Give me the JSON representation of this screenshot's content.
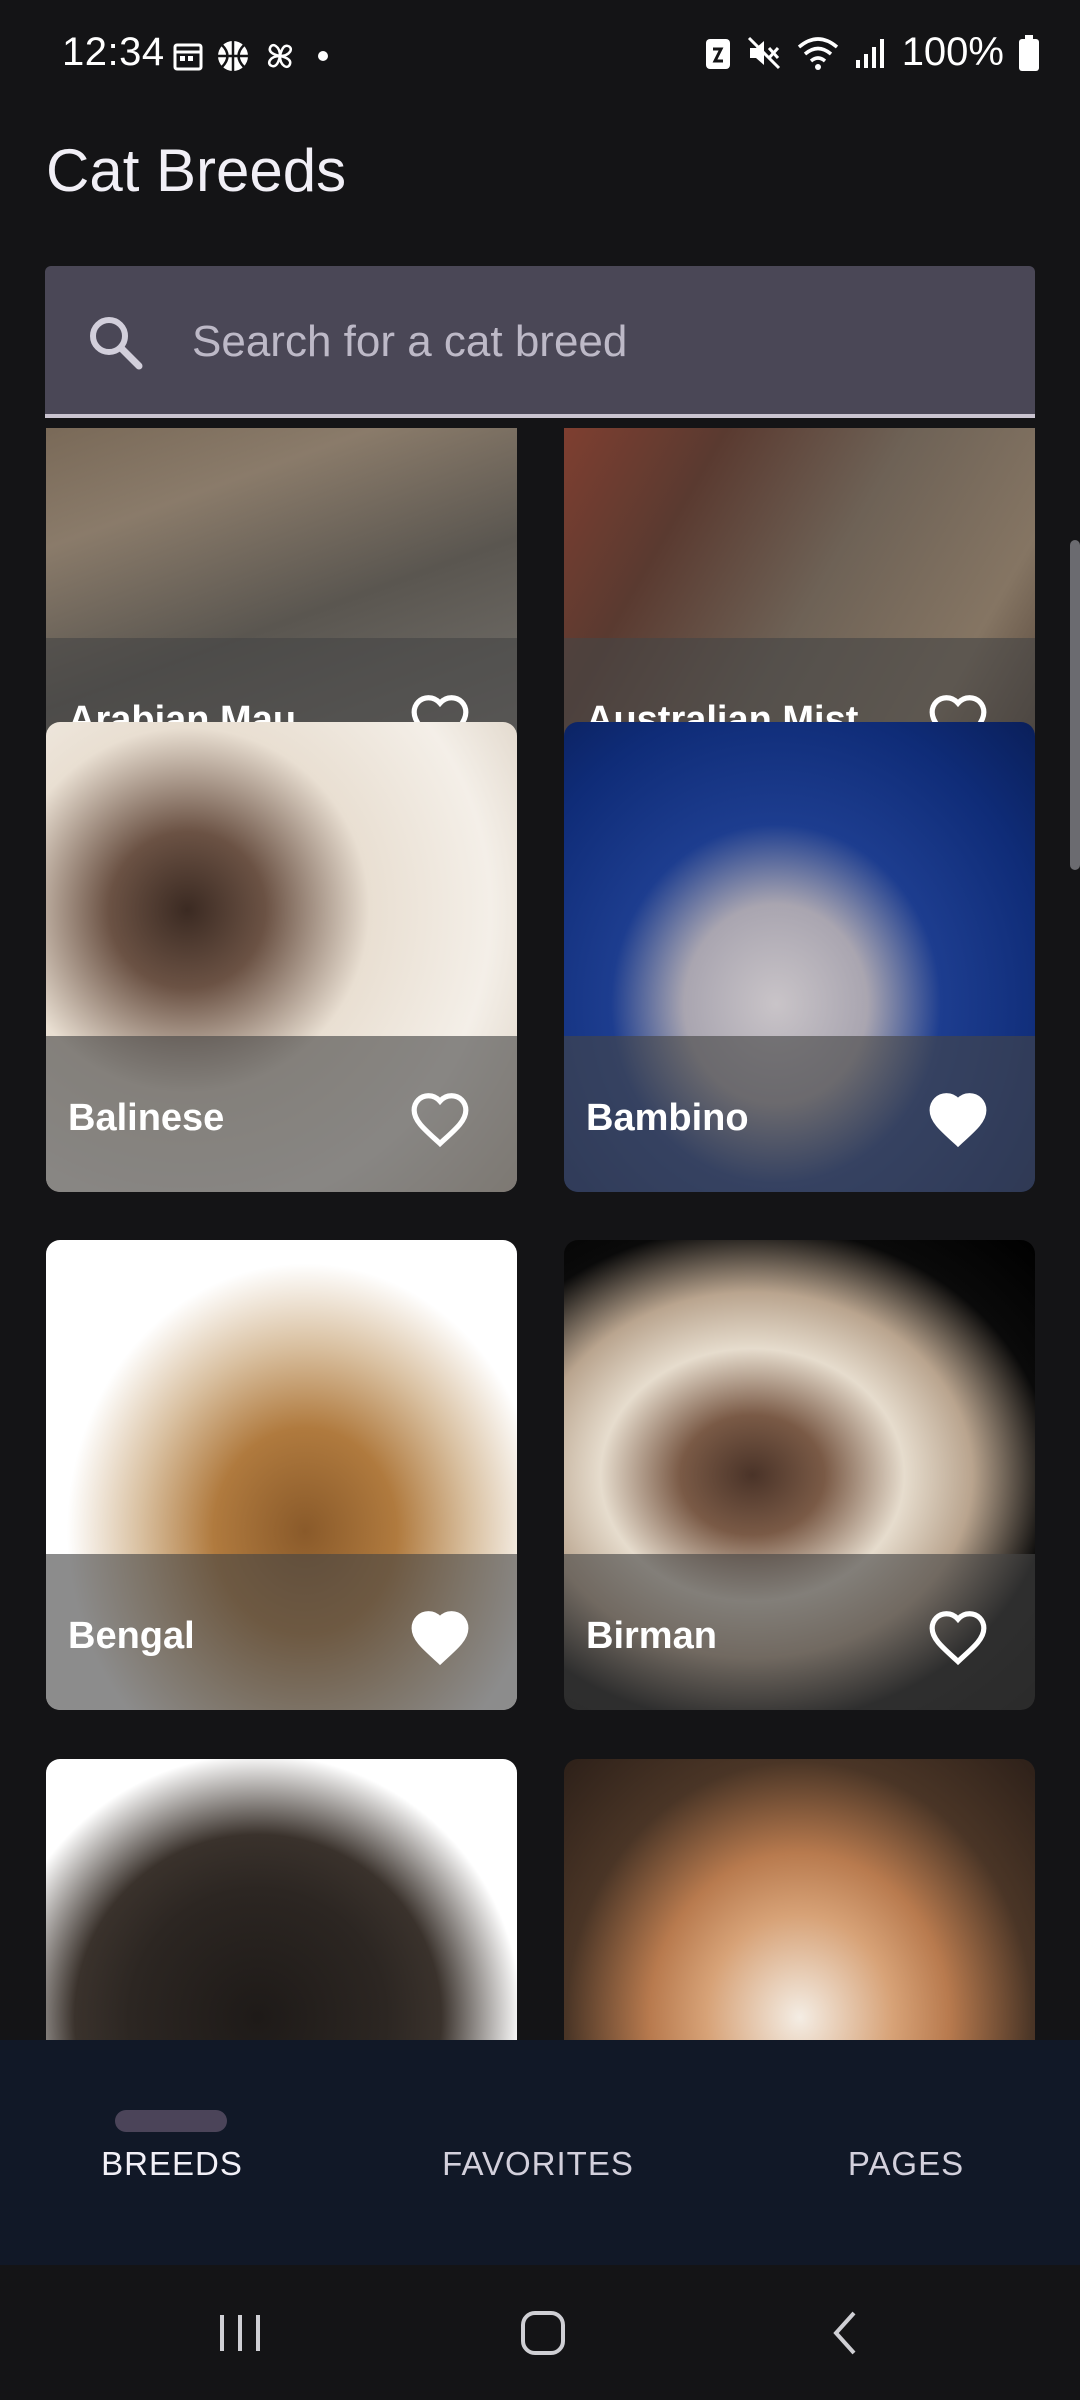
{
  "status_bar": {
    "time": "12:34",
    "battery_percent": "100%",
    "left_icons": [
      "calendar-icon",
      "basketball-icon",
      "pinwheel-icon",
      "dot-icon"
    ],
    "right_icons": [
      "nfc-icon",
      "mute-icon",
      "wifi-icon",
      "signal-icon",
      "battery-icon"
    ]
  },
  "title": "Cat Breeds",
  "search": {
    "placeholder": "Search for a cat breed",
    "value": ""
  },
  "breeds": [
    {
      "name": "Arabian Mau",
      "favorite": false
    },
    {
      "name": "Australian Mist",
      "favorite": false
    },
    {
      "name": "Balinese",
      "favorite": false
    },
    {
      "name": "Bambino",
      "favorite": true
    },
    {
      "name": "Bengal",
      "favorite": true
    },
    {
      "name": "Birman",
      "favorite": false
    },
    {
      "name": "",
      "favorite": false
    },
    {
      "name": "",
      "favorite": false
    }
  ],
  "bottom_nav": {
    "items": [
      {
        "label": "BREEDS",
        "active": true
      },
      {
        "label": "FAVORITES",
        "active": false
      },
      {
        "label": "PAGES",
        "active": false
      }
    ]
  },
  "colors": {
    "background": "#141416",
    "search_bg": "#4a4756",
    "nav_bg": "#111827",
    "nav_indicator": "#4b4459"
  }
}
